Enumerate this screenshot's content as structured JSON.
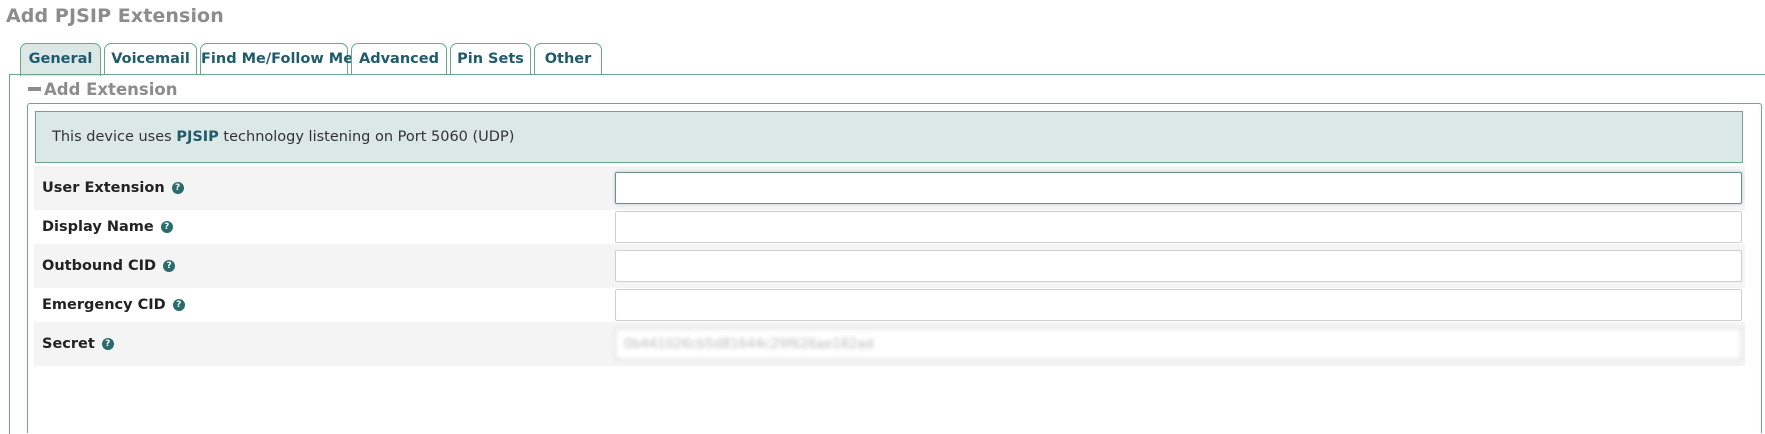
{
  "page": {
    "title": "Add PJSIP Extension"
  },
  "tabs": [
    {
      "label": "General",
      "active": true
    },
    {
      "label": "Voicemail",
      "active": false
    },
    {
      "label": "Find Me/Follow Me",
      "active": false
    },
    {
      "label": "Advanced",
      "active": false
    },
    {
      "label": "Pin Sets",
      "active": false
    },
    {
      "label": "Other",
      "active": false
    }
  ],
  "section": {
    "label": "Add Extension",
    "icon": "minus-icon"
  },
  "info": {
    "prefix": "This device uses ",
    "technology": "PJSIP",
    "suffix": " technology listening on Port 5060 (UDP)"
  },
  "fields": [
    {
      "label": "User Extension",
      "value": "",
      "help_icon": "question-circle-icon"
    },
    {
      "label": "Display Name",
      "value": "",
      "help_icon": "question-circle-icon"
    },
    {
      "label": "Outbound CID",
      "value": "",
      "help_icon": "question-circle-icon"
    },
    {
      "label": "Emergency CID",
      "value": "",
      "help_icon": "question-circle-icon"
    },
    {
      "label": "Secret",
      "value": "0b441026cb5d81644c29f626ae182ad",
      "help_icon": "question-circle-icon"
    }
  ],
  "colors": {
    "accent": "#1f5b6b",
    "border": "#6aa88c",
    "info_bg": "#dbe8e6",
    "title_gray": "#8c8c8c"
  }
}
